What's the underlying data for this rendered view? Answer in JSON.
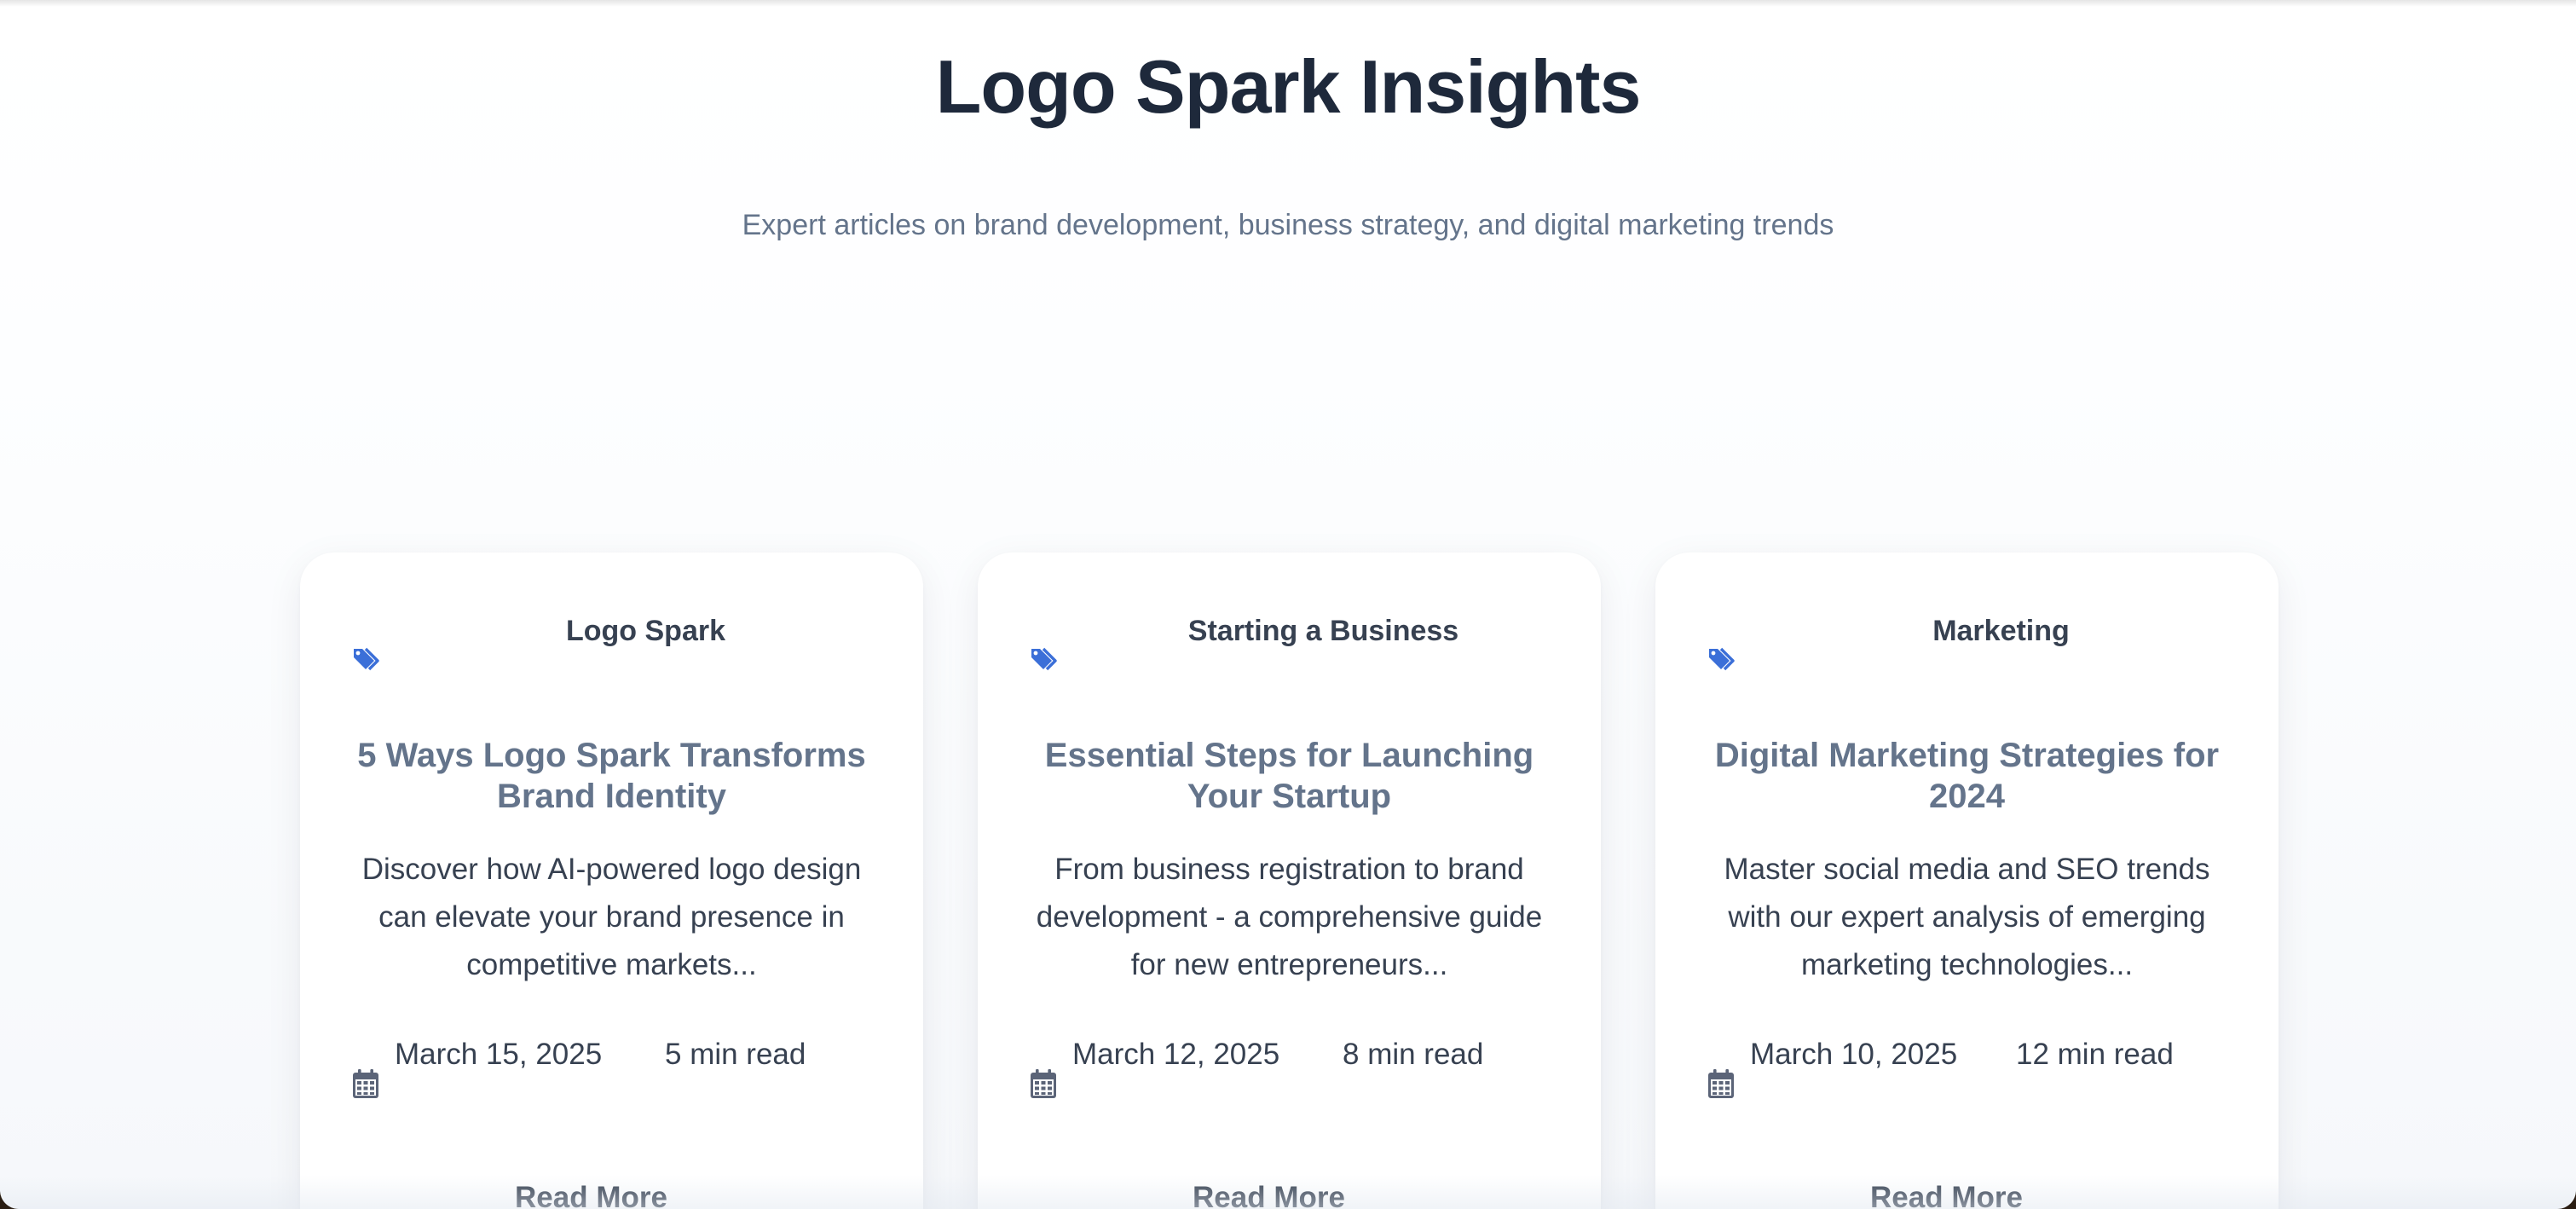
{
  "header": {
    "title": "Logo Spark Insights",
    "subtitle": "Expert articles on brand development, business strategy, and digital marketing trends"
  },
  "colors": {
    "icon_accent": "#3b6fd8",
    "meta_icon": "#5b6478",
    "title_text": "#1e293b",
    "muted_text": "#64748b"
  },
  "icons": {
    "category": "tags-icon",
    "date": "calendar-icon"
  },
  "posts": [
    {
      "category": "Logo Spark",
      "title": "5 Ways Logo Spark Transforms Brand Identity",
      "excerpt": "Discover how AI-powered logo design can elevate your brand presence in competitive markets...",
      "date": "March 15, 2025",
      "read_time": "5 min read",
      "cta": "Read More"
    },
    {
      "category": "Starting a Business",
      "title": "Essential Steps for Launching Your Startup",
      "excerpt": "From business registration to brand development - a comprehensive guide for new entrepreneurs...",
      "date": "March 12, 2025",
      "read_time": "8 min read",
      "cta": "Read More"
    },
    {
      "category": "Marketing",
      "title": "Digital Marketing Strategies for 2024",
      "excerpt": "Master social media and SEO trends with our expert analysis of emerging marketing technologies...",
      "date": "March 10, 2025",
      "read_time": "12 min read",
      "cta": "Read More"
    }
  ]
}
